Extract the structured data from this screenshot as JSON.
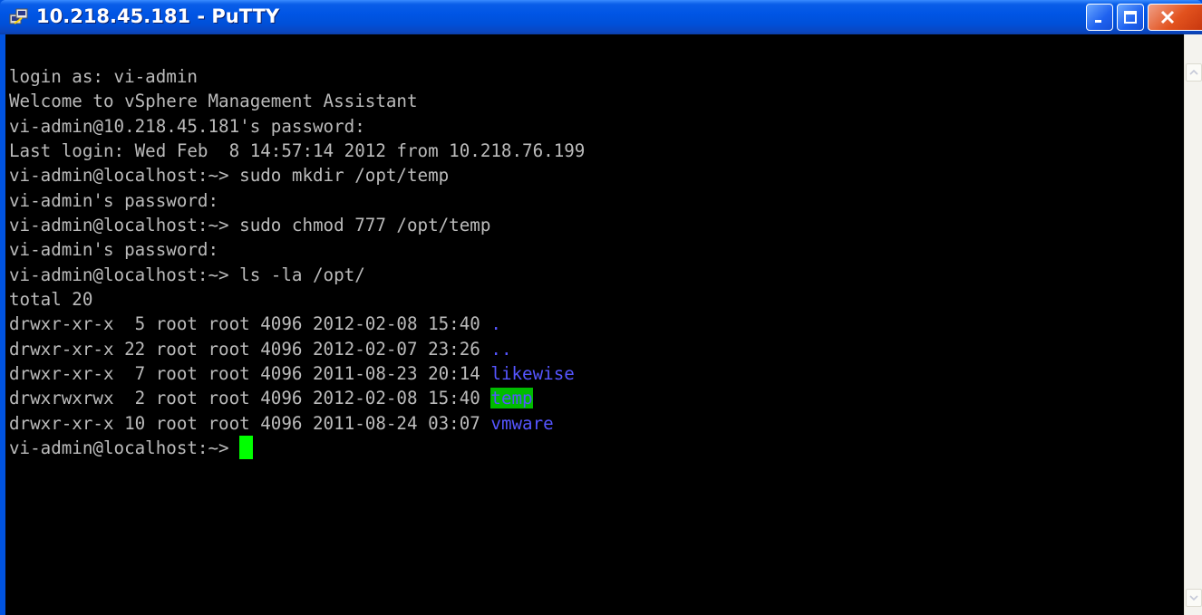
{
  "window": {
    "title": "10.218.45.181 - PuTTY",
    "icon": "putty-icon",
    "controls": {
      "minimize_icon": "minimize-icon",
      "maximize_icon": "maximize-icon",
      "close_icon": "close-icon"
    }
  },
  "terminal": {
    "lines": [
      "login as: vi-admin",
      "Welcome to vSphere Management Assistant",
      "vi-admin@10.218.45.181's password:",
      "Last login: Wed Feb  8 14:57:14 2012 from 10.218.76.199",
      "vi-admin@localhost:~> sudo mkdir /opt/temp",
      "vi-admin's password:",
      "vi-admin@localhost:~> sudo chmod 777 /opt/temp",
      "vi-admin's password:",
      "vi-admin@localhost:~> ls -la /opt/",
      "total 20"
    ],
    "listing": [
      {
        "perms": "drwxr-xr-x  5 root root 4096 2012-02-08 15:40 ",
        "name": "."
      },
      {
        "perms": "drwxr-xr-x 22 root root 4096 2012-02-07 23:26 ",
        "name": ".."
      },
      {
        "perms": "drwxr-xr-x  7 root root 4096 2011-08-23 20:14 ",
        "name": "likewise"
      },
      {
        "perms": "drwxrwxrwx  2 root root 4096 2012-02-08 15:40 ",
        "name": "temp"
      },
      {
        "perms": "drwxr-xr-x 10 root root 4096 2011-08-24 03:07 ",
        "name": "vmware"
      }
    ],
    "prompt": "vi-admin@localhost:~> ",
    "colors": {
      "background": "#000000",
      "text": "#bbbbbb",
      "dir": "#5555ff",
      "highlight": "#00bb00",
      "cursor": "#00ff00"
    }
  },
  "scrollbar": {
    "up_icon": "scroll-up-arrow-icon",
    "down_icon": "scroll-down-arrow-icon"
  }
}
